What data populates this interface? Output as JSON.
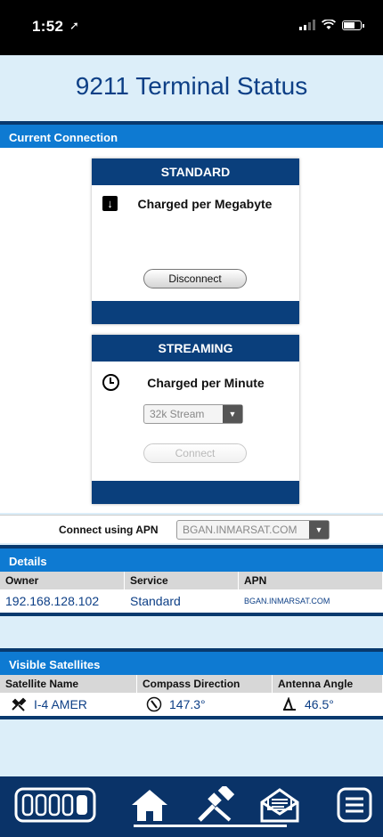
{
  "status_bar": {
    "time": "1:52"
  },
  "page_title": "9211 Terminal Status",
  "current_connection": {
    "header": "Current Connection",
    "standard": {
      "title": "STANDARD",
      "charge": "Charged per Megabyte",
      "button": "Disconnect",
      "icon": "download-icon"
    },
    "streaming": {
      "title": "STREAMING",
      "charge": "Charged per Minute",
      "stream_select": "32k Stream",
      "button": "Connect",
      "icon": "clock-icon"
    },
    "apn_label": "Connect using APN",
    "apn_value": "BGAN.INMARSAT.COM"
  },
  "details": {
    "header": "Details",
    "columns": [
      "Owner",
      "Service",
      "APN"
    ],
    "row": [
      "192.168.128.102",
      "Standard",
      "BGAN.INMARSAT.COM"
    ]
  },
  "satellites": {
    "header": "Visible Satellites",
    "columns": [
      "Satellite Name",
      "Compass Direction",
      "Antenna Angle"
    ],
    "row": [
      "I-4 AMER",
      "147.3°",
      "46.5°"
    ]
  },
  "colors": {
    "accent": "#0e7ad2",
    "dark": "#0a3f7c",
    "title": "#0d3f86",
    "background": "#dceef9"
  },
  "nav": {
    "items": [
      "signal-strength-icon",
      "home-icon",
      "satellite-icon",
      "mail-icon",
      "menu-icon"
    ],
    "active": "home-icon"
  }
}
